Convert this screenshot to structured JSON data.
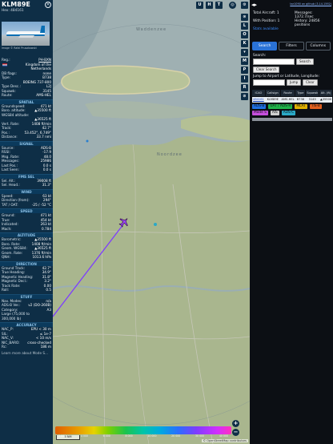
{
  "aircraft": {
    "callsign": "KLM89E",
    "hex_line": "Hex: 484161",
    "image_credit": "Image © Rafal Prusakowski",
    "reg_label": "Reg.:",
    "reg_value": "PH-BXN",
    "country": "Kingdom of the Netherlands",
    "db_flags_label": "DB flags:",
    "db_flags_value": "none",
    "type_label": "Type:",
    "type_value": "B738",
    "type_name": "BOEING 737-800",
    "type_desc_label": "Type Desc.:",
    "type_desc_value": "L2J",
    "squawk_label": "Squawk:",
    "squawk_value": "3145",
    "route_label": "Route:",
    "route_value": "AMS-HEL"
  },
  "spatial": {
    "title": "SPATIAL",
    "rows": [
      {
        "k": "Groundspeed:",
        "v": "471 kt"
      },
      {
        "k": "Baro. altitude:",
        "v": "▲35500 ft"
      },
      {
        "k": "WGS84 altitude:",
        "v": ""
      },
      {
        "k": "",
        "v": "▲36525 ft"
      },
      {
        "k": "Vert. Rate:",
        "v": "1408 ft/min"
      },
      {
        "k": "Track:",
        "v": "42.7°"
      },
      {
        "k": "Pos.:",
        "v": "53.452°, 6.749°"
      },
      {
        "k": "Distance:",
        "v": "33.7 nmi"
      }
    ]
  },
  "signal": {
    "title": "SIGNAL",
    "rows": [
      {
        "k": "Source:",
        "v": "ADS-B"
      },
      {
        "k": "RSSI:",
        "v": "-17.9"
      },
      {
        "k": "Msg. Rate:",
        "v": "48.0"
      },
      {
        "k": "Messages:",
        "v": "25986"
      },
      {
        "k": "Last Pos.:",
        "v": "0.0 s"
      },
      {
        "k": "Last Seen:",
        "v": "0.0 s"
      }
    ]
  },
  "fms": {
    "title": "FMS SEL",
    "rows": [
      {
        "k": "Sel. Alt.:",
        "v": "39008 ft"
      },
      {
        "k": "Sel. Head.:",
        "v": "31.3°"
      }
    ]
  },
  "wind": {
    "title": "WIND",
    "rows": [
      {
        "k": "Speed:",
        "v": "63 kt"
      },
      {
        "k": "Direction (from):",
        "v": "294°"
      },
      {
        "k": "TAT / OAT:",
        "v": "-25 / -52 °C"
      }
    ]
  },
  "speed": {
    "title": "SPEED",
    "rows": [
      {
        "k": "Ground:",
        "v": "471 kt"
      },
      {
        "k": "True:",
        "v": "454 kt"
      },
      {
        "k": "Indicated:",
        "v": "263 kt"
      },
      {
        "k": "Mach:",
        "v": "0.784"
      }
    ]
  },
  "altitude": {
    "title": "ALTITUDE",
    "rows": [
      {
        "k": "Barometric:",
        "v": "▲35500 ft"
      },
      {
        "k": "Baro. Rate:",
        "v": "1408 ft/min"
      },
      {
        "k": "Geom. WGS84:",
        "v": "▲36525 ft"
      },
      {
        "k": "Geom. Rate:",
        "v": "1376 ft/min"
      },
      {
        "k": "QNH:",
        "v": "1013.6 hPa"
      }
    ]
  },
  "direction": {
    "title": "DIRECTION",
    "rows": [
      {
        "k": "Ground Track:",
        "v": "42.7°"
      },
      {
        "k": "True Heading:",
        "v": "34.9°"
      },
      {
        "k": "Magnetic Heading:",
        "v": "31.8°"
      },
      {
        "k": "Magnetic Decl.:",
        "v": "3.2°"
      },
      {
        "k": "Track Rate:",
        "v": "0.00"
      },
      {
        "k": "Roll:",
        "v": "0.5"
      }
    ]
  },
  "stuff": {
    "title": "STUFF",
    "rows": [
      {
        "k": "Nav. Modes:",
        "v": "n/a"
      },
      {
        "k": "ADS-B Ver.:",
        "v": "v2 (DO-260B)"
      },
      {
        "k": "Category:",
        "v": "A3"
      },
      {
        "k": "Large (75,000 to",
        "v": ""
      },
      {
        "k": "300,000 lb)",
        "v": ""
      }
    ]
  },
  "accuracy": {
    "title": "ACCURACY",
    "rows": [
      {
        "k": "NAC_P:",
        "v": "EPU < 30 m"
      },
      {
        "k": "SIL:",
        "v": "≤ 1e-7"
      },
      {
        "k": "NAC_V:",
        "v": "< 10 m/s"
      },
      {
        "k": "NIC_BARO:",
        "v": "cross-checked"
      },
      {
        "k": "Rc:",
        "v": "186 m"
      }
    ],
    "footer": "Learn more about Mode S..."
  },
  "map": {
    "top_buttons": [
      "U",
      "H",
      "T"
    ],
    "side_buttons": [
      "L",
      "O",
      "K",
      "M",
      "P",
      "I",
      "R"
    ],
    "labels": [
      "Waddenzee",
      "Noordzee"
    ],
    "scale_text": "5 NM",
    "attribution": "© OpenStreetMap contributors",
    "altitude_ticks": [
      "2 000",
      "4 000",
      "6 000",
      "8 000",
      "10 000",
      "20 000",
      "30 000",
      "40 000"
    ],
    "zoom_in": "+",
    "zoom_out": "−"
  },
  "right_panel": {
    "arrows": "◂▸",
    "top_link": "tar1090 on github (3.14.1592)",
    "total_aircraft": "Total Aircraft: 1",
    "messages_label": "Messages:",
    "messages_value": "1372.7/sec",
    "with_position": "With Position: 1",
    "history": "History: 24856 positions",
    "stats_available": "Stats available",
    "tabs": [
      "Search",
      "Filters",
      "Columns"
    ],
    "search_label": "Search:",
    "search_button": "Search",
    "clear_search": "Clear Search",
    "jump_label": "Jump to Airport or Latitude, Longitude:",
    "jump_button": "Jump",
    "clear_button": "Clear",
    "table_headers": [
      "ICAO",
      "Callsign",
      "Route",
      "Type",
      "Squawk",
      "Alt. (ft)"
    ],
    "row": {
      "icao": "484161",
      "callsign": "KLM89E",
      "route": "AMS-HEL",
      "type": "B738",
      "squawk": "3145",
      "alt": "▲35500"
    },
    "sources": [
      {
        "label": "ADS-B",
        "color": "#1f6fe0"
      },
      {
        "label": "UAT / ADS-R",
        "color": "#1fb34a"
      },
      {
        "label": "MLAT",
        "color": "#e0b000"
      },
      {
        "label": "TIS-B",
        "color": "#e06020"
      },
      {
        "label": "Mode S",
        "color": "#c64fdc"
      },
      {
        "label": "AIS",
        "color": "#cfcfcf"
      },
      {
        "label": "ADS-C",
        "color": "#2aa9c7"
      }
    ]
  }
}
